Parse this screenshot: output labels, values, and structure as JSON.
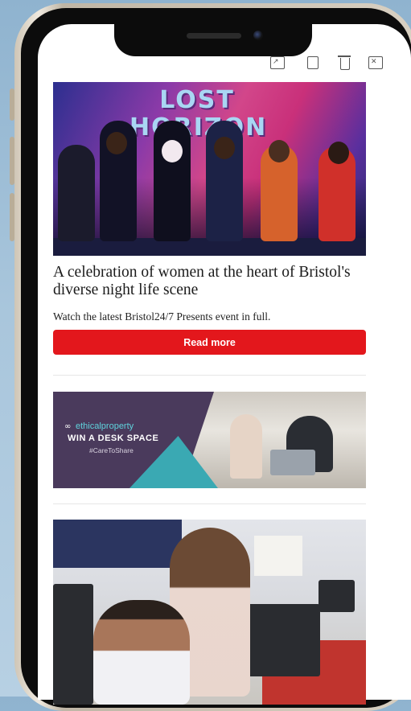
{
  "toolbar": {
    "icons": [
      "image-icon",
      "archive-icon",
      "trash-icon",
      "close-box-icon"
    ]
  },
  "hero": {
    "mural_text": "LOST HORIZON",
    "headline": "A celebration of women at the heart of Bristol's diverse night life scene",
    "subline": "Watch the latest Bristol24/7 Presents event in full.",
    "cta_label": "Read more"
  },
  "ad": {
    "brand": "ethicalproperty",
    "promo": "WIN A DESK SPACE",
    "tag": "#CareToShare"
  },
  "colors": {
    "accent": "#e3171c",
    "ad_panel": "#4a3a5c",
    "ad_teal": "#3aa9b3"
  }
}
